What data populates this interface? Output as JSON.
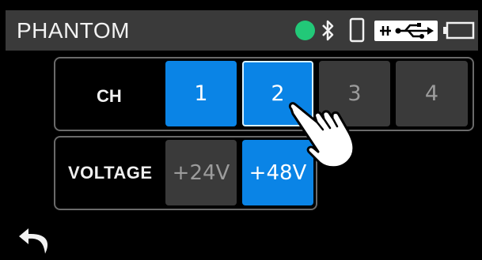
{
  "header": {
    "title": "PHANTOM",
    "status_icons": [
      "recording-indicator",
      "bluetooth-icon",
      "phone-icon",
      "usb-icon",
      "battery-icon"
    ],
    "status_color": "#22c878"
  },
  "channel": {
    "label": "CH",
    "buttons": [
      {
        "label": "1",
        "state": "on"
      },
      {
        "label": "2",
        "state": "on-focused"
      },
      {
        "label": "3",
        "state": "off"
      },
      {
        "label": "4",
        "state": "off"
      }
    ]
  },
  "voltage": {
    "label": "VOLTAGE",
    "buttons": [
      {
        "label": "+24V",
        "state": "off"
      },
      {
        "label": "+48V",
        "state": "on"
      }
    ]
  },
  "colors": {
    "accent": "#0a84e6",
    "inactive": "#3a3a3a",
    "background": "#000000"
  },
  "icons": {
    "back": "back-arrow-icon",
    "pointer": "hand-pointer-icon"
  }
}
